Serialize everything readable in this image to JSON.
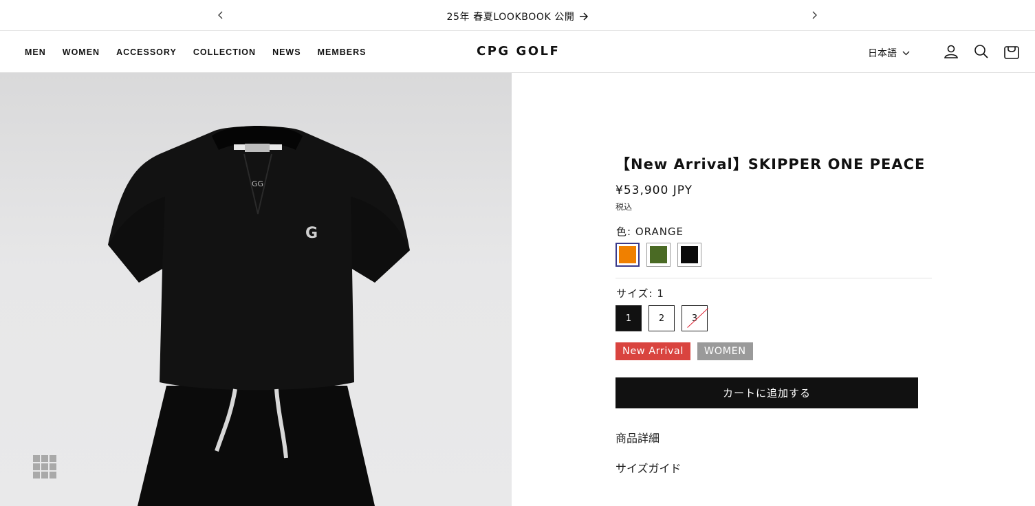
{
  "announcement": {
    "text": "25年 春夏LOOKBOOK 公開",
    "prev_icon": "chevron-left-icon",
    "next_icon": "chevron-right-icon",
    "link_icon": "arrow-right-icon"
  },
  "header": {
    "nav": [
      "MEN",
      "WOMEN",
      "ACCESSORY",
      "COLLECTION",
      "NEWS",
      "MEMBERS"
    ],
    "logo": "CPG GOLF",
    "language": "日本語",
    "icons": [
      "account-icon",
      "search-icon",
      "cart-icon"
    ]
  },
  "product": {
    "title": "【New Arrival】SKIPPER ONE PEACE",
    "price": "¥53,900 JPY",
    "tax_note": "税込",
    "color_label": "色: ORANGE",
    "colors": [
      {
        "name": "ORANGE",
        "hex": "#f08000",
        "selected": true
      },
      {
        "name": "GREEN",
        "hex": "#4a6a24",
        "selected": false
      },
      {
        "name": "BLACK",
        "hex": "#0a0a0a",
        "selected": false
      }
    ],
    "size_label": "サイズ: 1",
    "sizes": [
      {
        "label": "1",
        "selected": true,
        "sold_out": false
      },
      {
        "label": "2",
        "selected": false,
        "sold_out": false
      },
      {
        "label": "3",
        "selected": false,
        "sold_out": true
      }
    ],
    "badges": [
      {
        "label": "New Arrival",
        "color": "#d9443f"
      },
      {
        "label": "WOMEN",
        "color": "#9a9a9a"
      }
    ],
    "add_to_cart": "カートに追加する",
    "details_label": "商品詳細",
    "size_guide_label": "サイズガイド"
  },
  "gallery": {
    "grid_icon": "grid-icon"
  }
}
